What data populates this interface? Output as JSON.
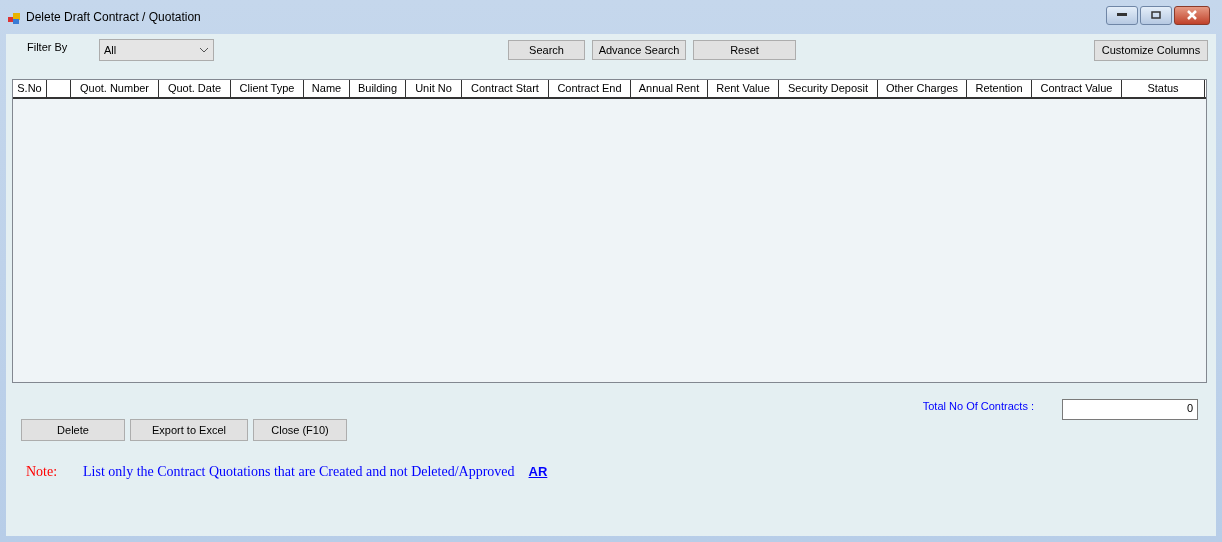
{
  "window": {
    "title": "Delete Draft Contract / Quotation"
  },
  "filter": {
    "label": "Filter By",
    "value": "All"
  },
  "top_buttons": [
    "Search",
    "Advance Search",
    "Reset"
  ],
  "customize_button": "Customize Columns",
  "table": {
    "columns": [
      {
        "kind": "text",
        "label": "S.No"
      },
      {
        "kind": "blank"
      },
      {
        "kind": "text",
        "label": "Quot. Number"
      },
      {
        "kind": "text",
        "label": "Quot. Date"
      },
      {
        "kind": "text",
        "label": "Client Type"
      },
      {
        "kind": "text",
        "label": "Name"
      },
      {
        "kind": "text",
        "label": "Building"
      },
      {
        "kind": "text",
        "label": "Unit No"
      },
      {
        "kind": "text",
        "label": "Contract Start"
      },
      {
        "kind": "text",
        "label": "Contract End"
      },
      {
        "kind": "text",
        "label": "Annual Rent"
      },
      {
        "kind": "text",
        "label": "Rent Value"
      },
      {
        "kind": "text",
        "label": "Security Deposit"
      },
      {
        "kind": "text",
        "label": "Other Charges"
      },
      {
        "kind": "text",
        "label": "Retention"
      },
      {
        "kind": "text",
        "label": "Contract Value"
      },
      {
        "kind": "text",
        "label": "Status"
      }
    ]
  },
  "total": {
    "label": "Total No Of Contracts :",
    "value": "0"
  },
  "bottom_buttons": [
    "Delete",
    "Export to Excel",
    "Close (F10)"
  ],
  "note": {
    "label": "Note:",
    "text": "List only the Contract Quotations that are Created and not Deleted/Approved",
    "link": "AR"
  }
}
